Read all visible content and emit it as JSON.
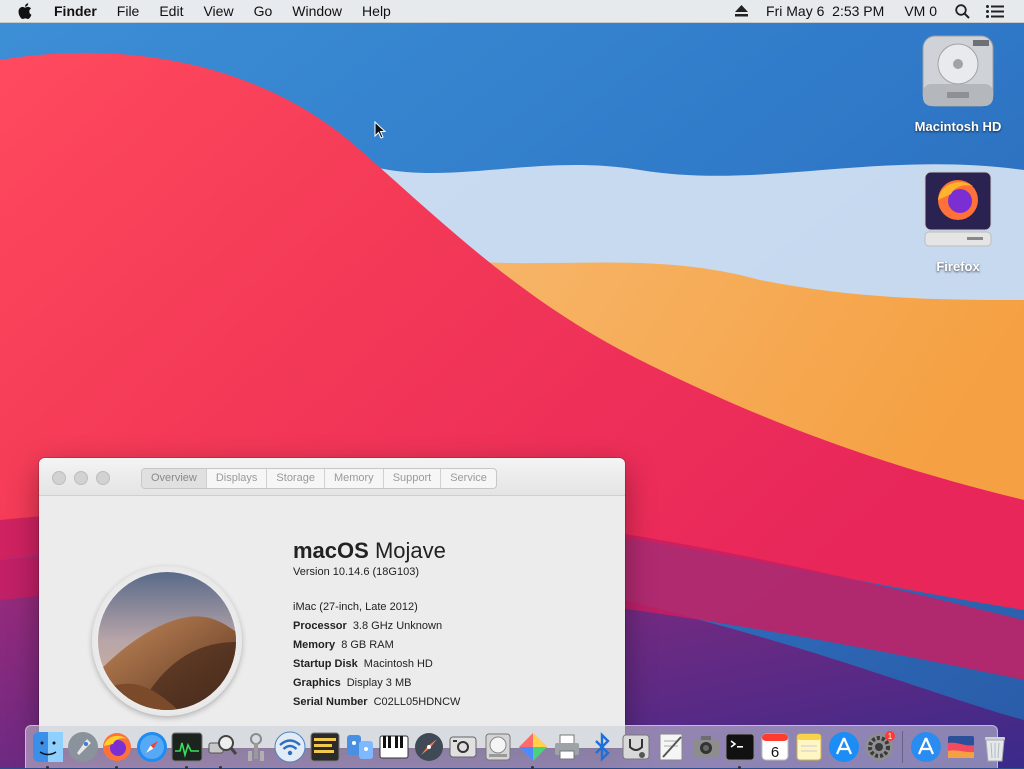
{
  "menubar": {
    "items": [
      {
        "label": "Finder",
        "name": "menu-finder"
      },
      {
        "label": "File",
        "name": "menu-file"
      },
      {
        "label": "Edit",
        "name": "menu-edit"
      },
      {
        "label": "View",
        "name": "menu-view"
      },
      {
        "label": "Go",
        "name": "menu-go"
      },
      {
        "label": "Window",
        "name": "menu-window"
      },
      {
        "label": "Help",
        "name": "menu-help"
      }
    ],
    "datetime": "Fri May 6  2:53 PM",
    "user": "VM 0"
  },
  "desktop": {
    "icons": [
      {
        "label": "Macintosh HD"
      },
      {
        "label": "Firefox"
      }
    ]
  },
  "about": {
    "tabs": [
      "Overview",
      "Displays",
      "Storage",
      "Memory",
      "Support",
      "Service"
    ],
    "os_name_bold": "macOS",
    "os_name_light": "Mojave",
    "version_label": "Version",
    "version": "10.14.6 (18G103)",
    "model": "iMac (27-inch, Late 2012)",
    "specs": [
      {
        "key": "Processor",
        "value": "3.8 GHz Unknown"
      },
      {
        "key": "Memory",
        "value": "8 GB RAM"
      },
      {
        "key": "Startup Disk",
        "value": "Macintosh HD"
      },
      {
        "key": "Graphics",
        "value": "Display 3 MB"
      },
      {
        "key": "Serial Number",
        "value": "C02LL05HDNCW"
      }
    ]
  },
  "dock": {
    "calendar_day": "6",
    "badge_count": "1",
    "colors": {
      "finder": "#3b8fe8",
      "firefox": "#ff7139",
      "safari": "#1e8cf0",
      "accent": "#ff3b30"
    }
  }
}
